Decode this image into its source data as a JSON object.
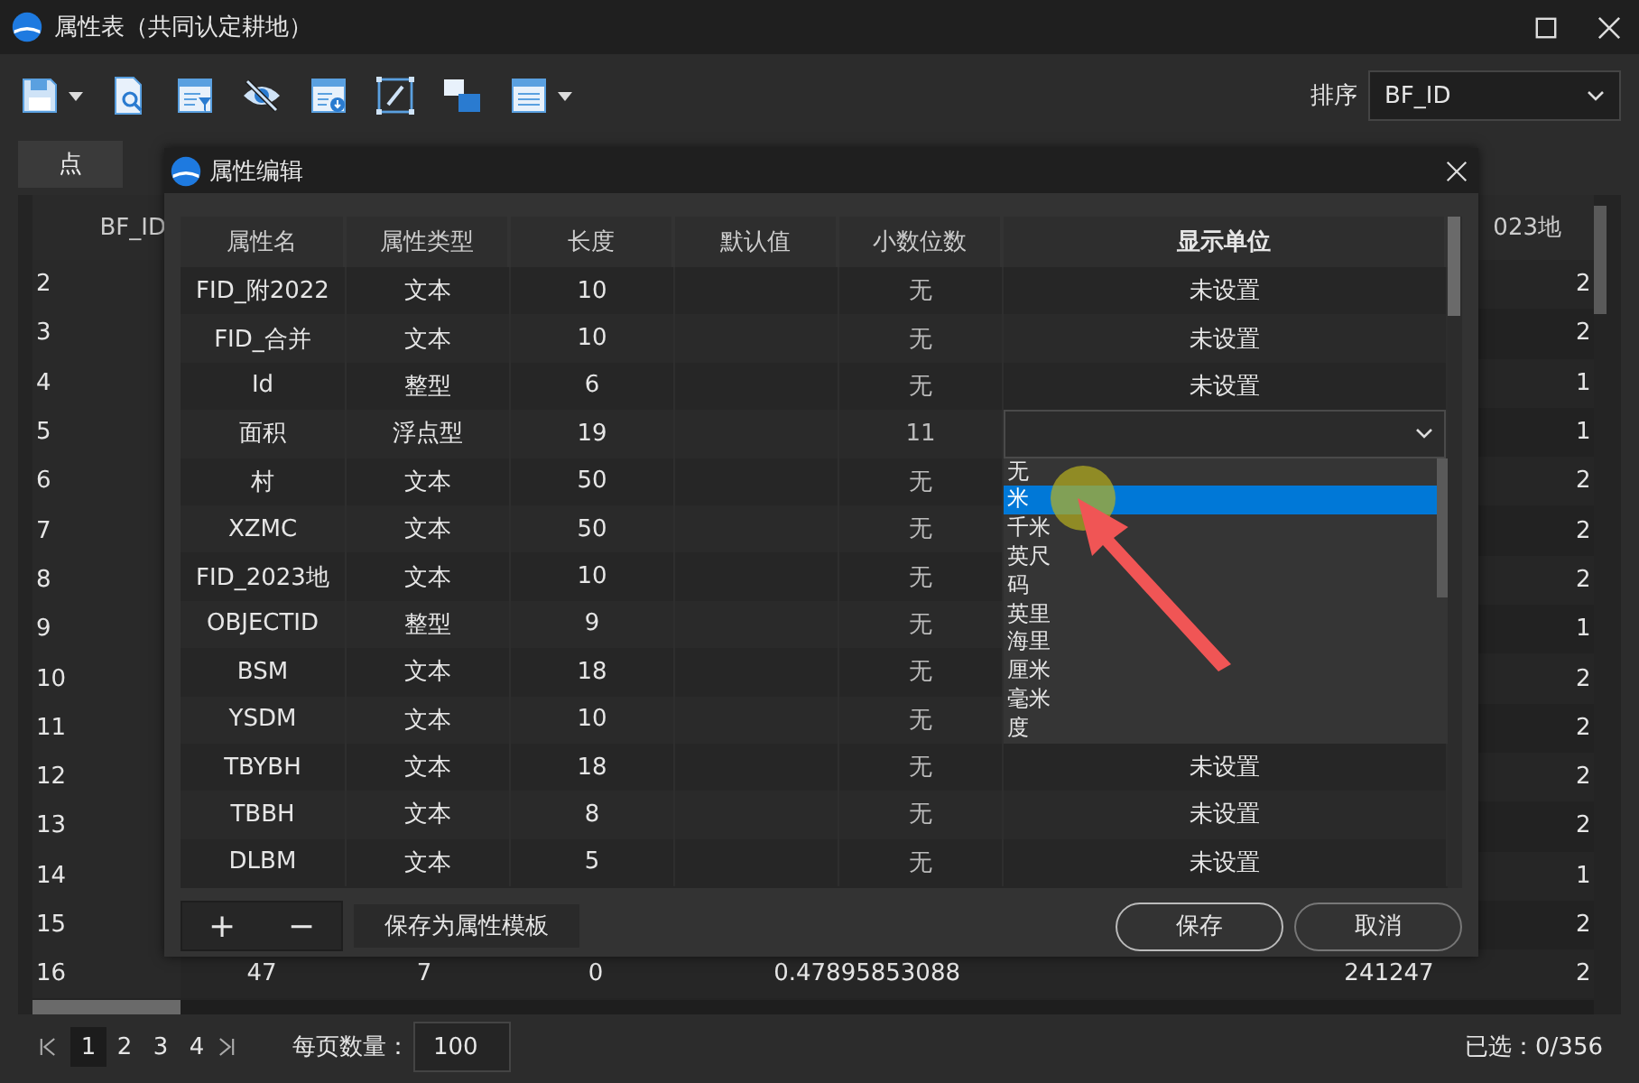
{
  "window": {
    "title": "属性表（共同认定耕地）"
  },
  "toolbar": [
    {
      "kind": "save",
      "dropdown": true
    },
    {
      "kind": "search-doc",
      "dropdown": false
    },
    {
      "kind": "filter",
      "dropdown": false
    },
    {
      "kind": "hide",
      "dropdown": false
    },
    {
      "kind": "export",
      "dropdown": false
    },
    {
      "kind": "edit",
      "dropdown": false
    },
    {
      "kind": "layers",
      "dropdown": false
    },
    {
      "kind": "list",
      "dropdown": true
    }
  ],
  "sort": {
    "label": "排序",
    "value": "BF_ID"
  },
  "tabs": [
    {
      "label": "点",
      "selected": true
    }
  ],
  "table": {
    "columns": {
      "column_1": "BF_ID",
      "column_9": "023地"
    },
    "rows": [
      {
        "column_1": "2",
        "column_10": "2"
      },
      {
        "column_1": "3",
        "column_10": "2"
      },
      {
        "column_1": "4",
        "column_10": "1"
      },
      {
        "column_1": "5",
        "column_10": "1"
      },
      {
        "column_1": "6",
        "column_10": "2"
      },
      {
        "column_1": "7",
        "column_10": "2"
      },
      {
        "column_1": "8",
        "column_10": "2"
      },
      {
        "column_1": "9",
        "column_10": "1"
      },
      {
        "column_1": "10",
        "column_10": "2"
      },
      {
        "column_1": "11",
        "column_10": "2"
      },
      {
        "column_1": "12",
        "column_10": "2"
      },
      {
        "column_1": "13",
        "column_10": "2"
      },
      {
        "column_1": "14",
        "column_10": "1"
      },
      {
        "column_1": "15",
        "column_10": "2"
      },
      {
        "column_1": "16",
        "column_2": "47",
        "column_3": "7",
        "column_4": "0",
        "column_5": "0.47895853088",
        "column_8": "241247",
        "column_10": "2"
      }
    ]
  },
  "dialog": {
    "title": "属性编辑",
    "columns": [
      "属性名",
      "属性类型",
      "长度",
      "默认值",
      "小数位数",
      "显示单位"
    ],
    "rows": [
      {
        "name": "FID_附2022",
        "type": "文本",
        "length": "10",
        "decimals": "无",
        "unit": "未设置",
        "editing": false
      },
      {
        "name": "FID_合并",
        "type": "文本",
        "length": "10",
        "decimals": "无",
        "unit": "未设置",
        "editing": false
      },
      {
        "name": "Id",
        "type": "整型",
        "length": "6",
        "decimals": "无",
        "unit": "未设置",
        "editing": false
      },
      {
        "name": "面积",
        "type": "浮点型",
        "length": "19",
        "decimals": "11",
        "editing": true
      },
      {
        "name": "村",
        "type": "文本",
        "length": "50",
        "decimals": "无",
        "editing": false
      },
      {
        "name": "XZMC",
        "type": "文本",
        "length": "50",
        "decimals": "无",
        "editing": false
      },
      {
        "name": "FID_2023地",
        "type": "文本",
        "length": "10",
        "decimals": "无",
        "editing": false
      },
      {
        "name": "OBJECTID",
        "type": "整型",
        "length": "9",
        "decimals": "无",
        "editing": false
      },
      {
        "name": "BSM",
        "type": "文本",
        "length": "18",
        "decimals": "无",
        "editing": false
      },
      {
        "name": "YSDM",
        "type": "文本",
        "length": "10",
        "decimals": "无",
        "editing": false
      },
      {
        "name": "TBYBH",
        "type": "文本",
        "length": "18",
        "decimals": "无",
        "unit": "未设置",
        "editing": false
      },
      {
        "name": "TBBH",
        "type": "文本",
        "length": "8",
        "decimals": "无",
        "unit": "未设置",
        "editing": false
      },
      {
        "name": "DLBM",
        "type": "文本",
        "length": "5",
        "decimals": "无",
        "unit": "未设置",
        "editing": false
      }
    ],
    "unit_options": [
      {
        "label": "无",
        "selected": false
      },
      {
        "label": "米",
        "selected": true
      },
      {
        "label": "千米",
        "selected": false
      },
      {
        "label": "英尺",
        "selected": false
      },
      {
        "label": "码",
        "selected": false
      },
      {
        "label": "英里",
        "selected": false
      },
      {
        "label": "海里",
        "selected": false
      },
      {
        "label": "厘米",
        "selected": false
      },
      {
        "label": "毫米",
        "selected": false
      },
      {
        "label": "度",
        "selected": false
      }
    ],
    "add": "+",
    "remove": "−",
    "save_template": "保存为属性模板",
    "save": "保存",
    "cancel": "取消"
  },
  "pagination": {
    "pages": [
      {
        "label": "1",
        "selected": true
      },
      {
        "label": "2",
        "selected": false
      },
      {
        "label": "3",
        "selected": false
      },
      {
        "label": "4",
        "selected": false
      }
    ],
    "page_size_label": "每页数量：",
    "page_size": "100",
    "selection": "已选：0/356"
  },
  "annotation": {
    "kind": "arrow"
  }
}
